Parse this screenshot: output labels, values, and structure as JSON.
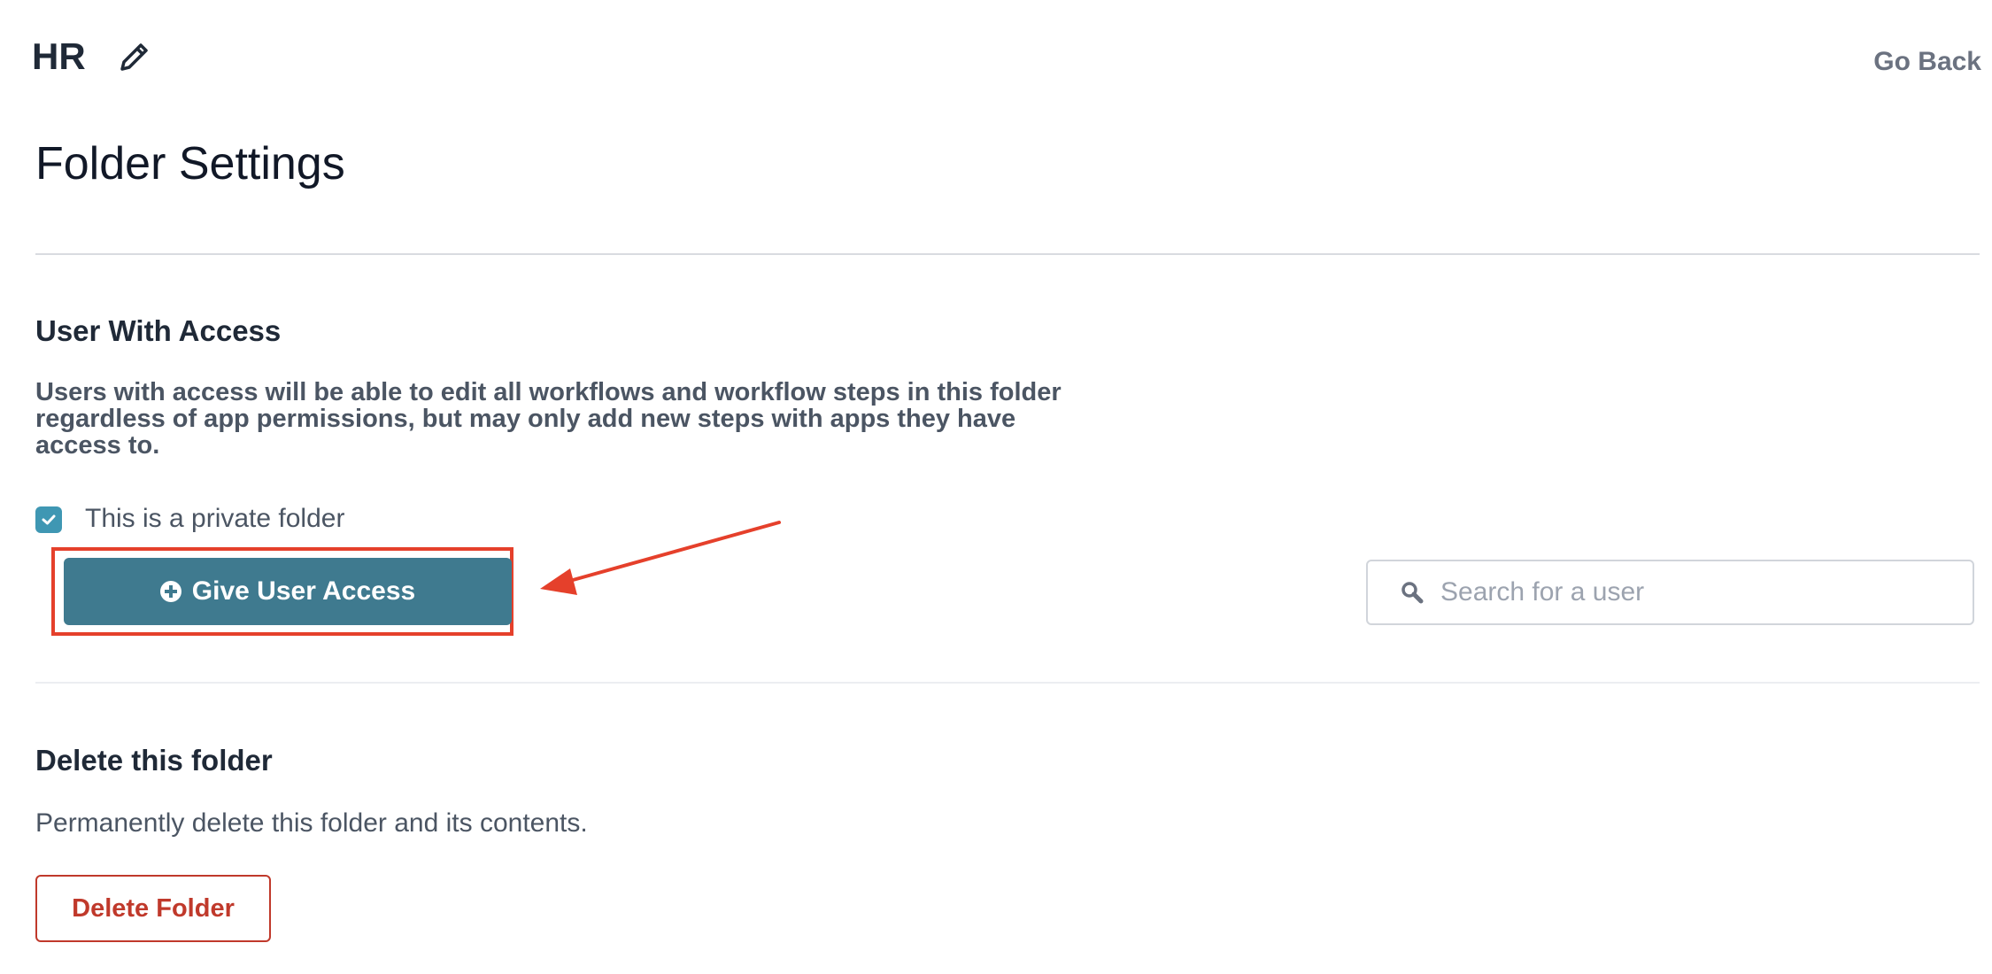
{
  "header": {
    "folder_name": "HR",
    "edit_icon": "pencil-icon",
    "go_back_label": "Go Back"
  },
  "page": {
    "title": "Folder Settings"
  },
  "access_section": {
    "heading": "User With Access",
    "description": "Users with access will be able to edit all workflows and workflow steps in this folder regardless of app permissions, but may only add new steps with apps they have access to.",
    "private_checkbox_label": "This is a private folder",
    "private_checked": true,
    "give_access_label": "Give User Access",
    "give_access_icon": "plus-circle-icon",
    "search_placeholder": "Search for a user",
    "search_value": "",
    "search_icon": "search-icon"
  },
  "delete_section": {
    "heading": "Delete this folder",
    "description": "Permanently delete this folder and its contents.",
    "delete_label": "Delete Folder"
  },
  "colors": {
    "primary_button": "#3f7a8f",
    "checkbox": "#3f97b3",
    "danger": "#c0392b",
    "annotation": "#e5402b"
  }
}
